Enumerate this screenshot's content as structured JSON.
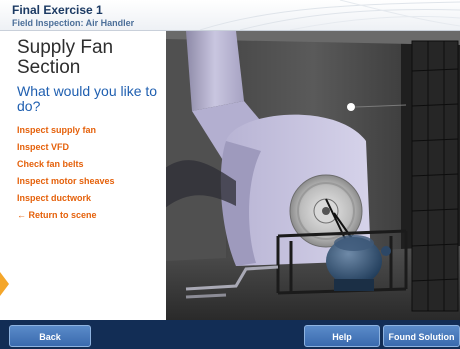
{
  "header": {
    "title": "Final Exercise 1",
    "subtitle": "Field Inspection: Air Handler"
  },
  "panel": {
    "section_title": "Supply Fan Section",
    "question": "What would you like to do?",
    "options": [
      "Inspect supply fan",
      "Inspect VFD",
      "Check fan belts",
      "Inspect motor sheaves",
      "Inspect ductwork",
      "← Return to scene"
    ]
  },
  "footer": {
    "back_label": "Back",
    "help_label": "Help",
    "found_solution_label": "Found Solution"
  },
  "colors": {
    "title": "#1c3a63",
    "subtitle": "#4c6f99",
    "question": "#1f5fb0",
    "option": "#e5610b",
    "bottom_bar": "#122d55",
    "button": "#4a7bbd"
  },
  "icons": {
    "return_arrow": "left-arrow-icon",
    "edge_marker": "orange-arrow-icon"
  }
}
